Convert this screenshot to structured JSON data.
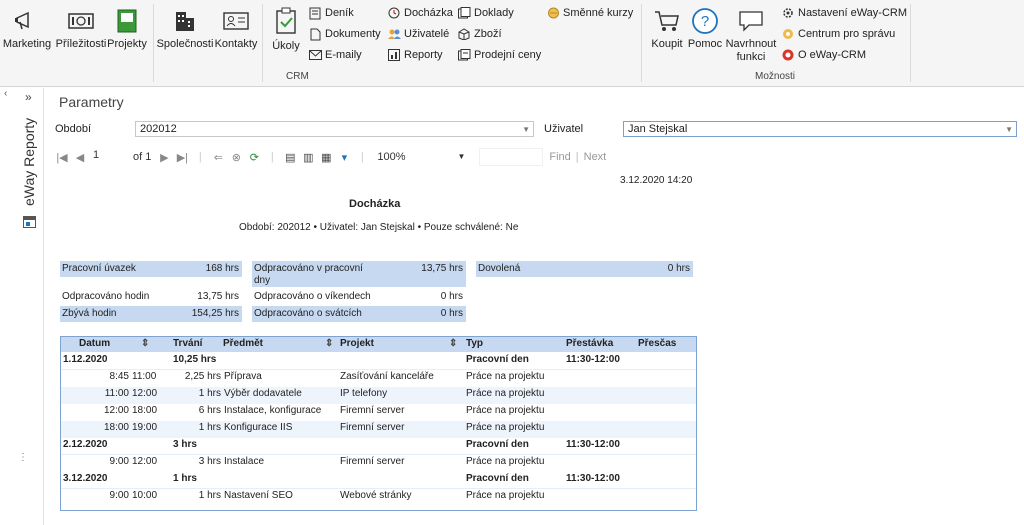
{
  "ribbon": {
    "buttons": [
      {
        "label": "Marketing",
        "icon": "megaphone-icon"
      },
      {
        "label": "Příležitosti",
        "icon": "opportunity-icon"
      },
      {
        "label": "Projekty",
        "icon": "projects-icon"
      },
      {
        "label": "Společnosti",
        "icon": "companies-icon"
      },
      {
        "label": "Kontakty",
        "icon": "contacts-icon"
      },
      {
        "label": "Úkoly",
        "icon": "tasks-icon"
      }
    ],
    "crm_small": [
      {
        "label": "Deník",
        "icon": "journal-icon"
      },
      {
        "label": "Dokumenty",
        "icon": "documents-icon"
      },
      {
        "label": "E-maily",
        "icon": "email-icon"
      },
      {
        "label": "Docházka",
        "icon": "attendance-icon"
      },
      {
        "label": "Uživatelé",
        "icon": "users-icon"
      },
      {
        "label": "Reporty",
        "icon": "reports-icon"
      },
      {
        "label": "Doklady",
        "icon": "invoices-icon"
      },
      {
        "label": "Zboží",
        "icon": "goods-icon"
      },
      {
        "label": "Prodejní ceny",
        "icon": "prices-icon"
      },
      {
        "label": "Směnné kurzy",
        "icon": "exchange-icon"
      }
    ],
    "crm_group": "CRM",
    "options_big": [
      {
        "label": "Koupit",
        "icon": "cart-icon"
      },
      {
        "label": "Pomoc",
        "icon": "help-icon"
      },
      {
        "label": "Navrhnout funkci",
        "icon": "suggest-icon"
      }
    ],
    "options_small": [
      {
        "label": "Nastavení eWay-CRM",
        "icon": "settings-icon"
      },
      {
        "label": "Centrum pro správu",
        "icon": "admin-icon"
      },
      {
        "label": "O eWay-CRM",
        "icon": "about-icon"
      }
    ],
    "options_group": "Možnosti"
  },
  "side": {
    "tab": "eWay Reporty",
    "chevron": "»"
  },
  "params": {
    "title": "Parametry",
    "period_label": "Období",
    "period_value": "202012",
    "user_label": "Uživatel",
    "user_value": "Jan Stejskal"
  },
  "toolbar": {
    "page": "1",
    "of": "of 1",
    "zoom": "100%",
    "find": "Find",
    "sep": "|",
    "next": "Next"
  },
  "report": {
    "timestamp": "3.12.2020 14:20",
    "title": "Docházka",
    "subtitle": "Období: 202012 • Uživatel: Jan Stejskal • Pouze schválené: Ne",
    "summary": {
      "pracovni_uvazek_label": "Pracovní úvazek",
      "pracovni_uvazek": "168 hrs",
      "odpracovano_hodin_label": "Odpracováno hodin",
      "odpracovano_hodin": "13,75 hrs",
      "zbyva_label": "Zbývá hodin",
      "zbyva": "154,25 hrs",
      "prac_dny_label": "Odpracováno v pracovní dny",
      "prac_dny": "13,75 hrs",
      "vikendy_label": "Odpracováno o víkendech",
      "vikendy": "0 hrs",
      "svatky_label": "Odpracováno o svátcích",
      "svatky": "0 hrs",
      "dovolena_label": "Dovolená",
      "dovolena": "0 hrs"
    },
    "columns": {
      "datum": "Datum",
      "trvani": "Trvání",
      "predmet": "Předmět",
      "projekt": "Projekt",
      "typ": "Typ",
      "prestavka": "Přestávka",
      "prescas": "Přesčas",
      "sort": "⇕"
    },
    "days": [
      {
        "date": "1.12.2020",
        "total": "10,25 hrs",
        "typ": "Pracovní den",
        "prestavka": "11:30-12:00",
        "items": [
          {
            "from": "8:45",
            "to": "11:00",
            "dur": "2,25 hrs",
            "subject": "Příprava",
            "project": "Zasíťování kanceláře",
            "typ": "Práce na projektu"
          },
          {
            "from": "11:00",
            "to": "12:00",
            "dur": "1 hrs",
            "subject": "Výběr dodavatele",
            "project": "IP telefony",
            "typ": "Práce na projektu"
          },
          {
            "from": "12:00",
            "to": "18:00",
            "dur": "6 hrs",
            "subject": "Instalace, konfigurace",
            "project": "Firemní server",
            "typ": "Práce na projektu"
          },
          {
            "from": "18:00",
            "to": "19:00",
            "dur": "1 hrs",
            "subject": "Konfigurace IIS",
            "project": "Firemní server",
            "typ": "Práce na projektu"
          }
        ]
      },
      {
        "date": "2.12.2020",
        "total": "3 hrs",
        "typ": "Pracovní den",
        "prestavka": "11:30-12:00",
        "items": [
          {
            "from": "9:00",
            "to": "12:00",
            "dur": "3 hrs",
            "subject": "Instalace",
            "project": "Firemní server",
            "typ": "Práce na projektu"
          }
        ]
      },
      {
        "date": "3.12.2020",
        "total": "1 hrs",
        "typ": "Pracovní den",
        "prestavka": "11:30-12:00",
        "items": [
          {
            "from": "9:00",
            "to": "10:00",
            "dur": "1 hrs",
            "subject": "Nastavení SEO",
            "project": "Webové stránky",
            "typ": "Práce na projektu"
          }
        ]
      }
    ]
  },
  "colors": {
    "accent": "#1e73be",
    "header_blue": "#c6d9f0",
    "band": "#eef4fb"
  }
}
